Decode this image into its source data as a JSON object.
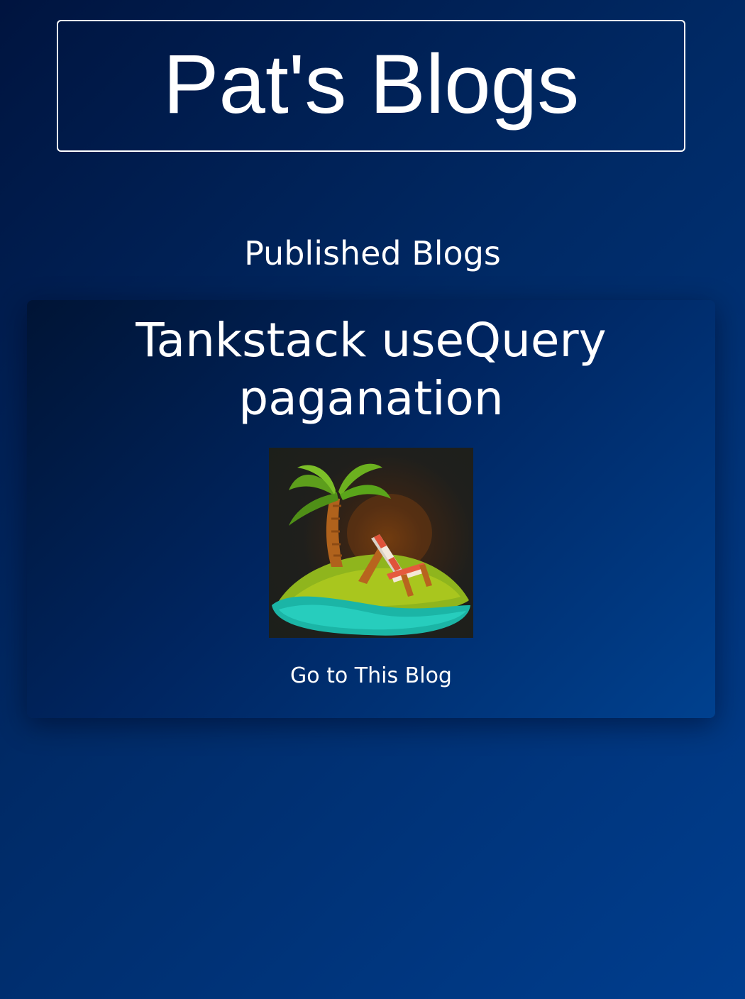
{
  "header": {
    "title": "Pat's Blogs"
  },
  "main": {
    "section_heading": "Published Blogs",
    "blogs": [
      {
        "title": "Tankstack useQuery paganation",
        "thumbnail_icon": "palm-island-chair-icon",
        "link_label": "Go to This Blog"
      }
    ]
  },
  "colors": {
    "background_start": "#00143f",
    "background_end": "#003e8f",
    "text": "#ffffff"
  }
}
